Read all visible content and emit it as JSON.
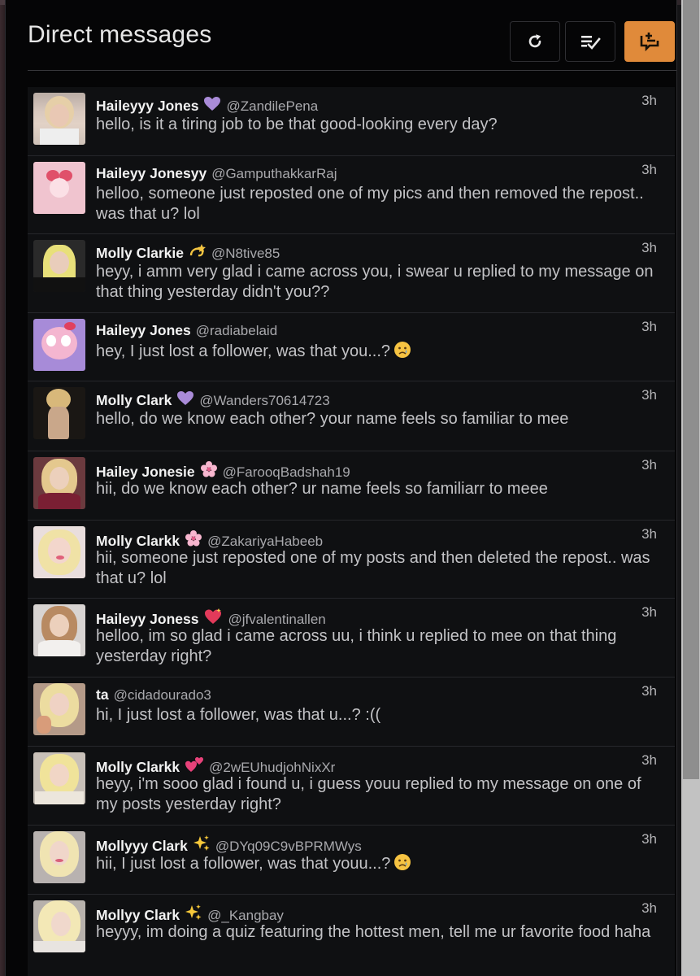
{
  "header": {
    "title": "Direct messages",
    "refresh_icon": "refresh-icon",
    "mark_read_icon": "mark-all-read-icon",
    "compose_icon": "new-message-icon",
    "accent_color": "#e08a3a"
  },
  "messages": [
    {
      "name": "Haileyyy Jones",
      "emoji": "purple-heart",
      "handle": "@ZandilePena",
      "time": "3h",
      "text": "hello, is it a tiring job to be that good-looking every day?",
      "msg_emoji": null
    },
    {
      "name": "Haileyy Jonesyy",
      "emoji": null,
      "handle": "@GamputhakkarRaj",
      "time": "3h",
      "text": "helloo, someone just reposted one of my pics and then removed the repost.. was that u? lol",
      "msg_emoji": null
    },
    {
      "name": "Molly Clarkie",
      "emoji": "dizzy",
      "handle": "@N8tive85",
      "time": "3h",
      "text": "heyy, i amm very glad i came across you, i swear u replied to my message on that thing yesterday didn't you??",
      "msg_emoji": null
    },
    {
      "name": "Haileyy Jones",
      "emoji": null,
      "handle": "@radiabelaid",
      "time": "3h",
      "text": "hey, I just lost a follower, was that you...?",
      "msg_emoji": "crying-face"
    },
    {
      "name": "Molly Clark",
      "emoji": "purple-heart",
      "handle": "@Wanders70614723",
      "time": "3h",
      "text": "hello, do we know each other? your name feels so familiar to mee",
      "msg_emoji": null
    },
    {
      "name": "Hailey Jonesie",
      "emoji": "cherry-blossom",
      "handle": "@FarooqBadshah19",
      "time": "3h",
      "text": "hii, do we know each other? ur name feels so familiarr to meee",
      "msg_emoji": null
    },
    {
      "name": "Molly Clarkk",
      "emoji": "cherry-blossom",
      "handle": "@ZakariyaHabeeb",
      "time": "3h",
      "text": "hii, someone just reposted one of my posts and then deleted the repost.. was that u? lol",
      "msg_emoji": null
    },
    {
      "name": "Haileyy Joness",
      "emoji": "sparkling-heart",
      "handle": "@jfvalentinallen",
      "time": "3h",
      "text": "helloo, im so glad i came across uu, i think u replied to mee on that thing yesterday right?",
      "msg_emoji": null
    },
    {
      "name": "ta",
      "emoji": null,
      "handle": "@cidadourado3",
      "time": "3h",
      "text": "hi, I just lost a follower, was that u...? :((",
      "msg_emoji": null
    },
    {
      "name": "Molly Clarkk",
      "emoji": "two-hearts",
      "handle": "@2wEUhudjohNixXr",
      "time": "3h",
      "text": "heyy, i'm sooo glad i found u, i guess youu replied to my message on one of my posts yesterday right?",
      "msg_emoji": null
    },
    {
      "name": "Mollyyy Clark",
      "emoji": "sparkles",
      "handle": "@DYq09C9vBPRMWys",
      "time": "3h",
      "text": "hii, I just lost a follower, was that youu...?",
      "msg_emoji": "crying-face"
    },
    {
      "name": "Mollyy Clark",
      "emoji": "sparkles",
      "handle": "@_Kangbay",
      "time": "3h",
      "text": "heyyy, im doing a quiz featuring the hottest men, tell me ur favorite food haha",
      "msg_emoji": null
    }
  ]
}
